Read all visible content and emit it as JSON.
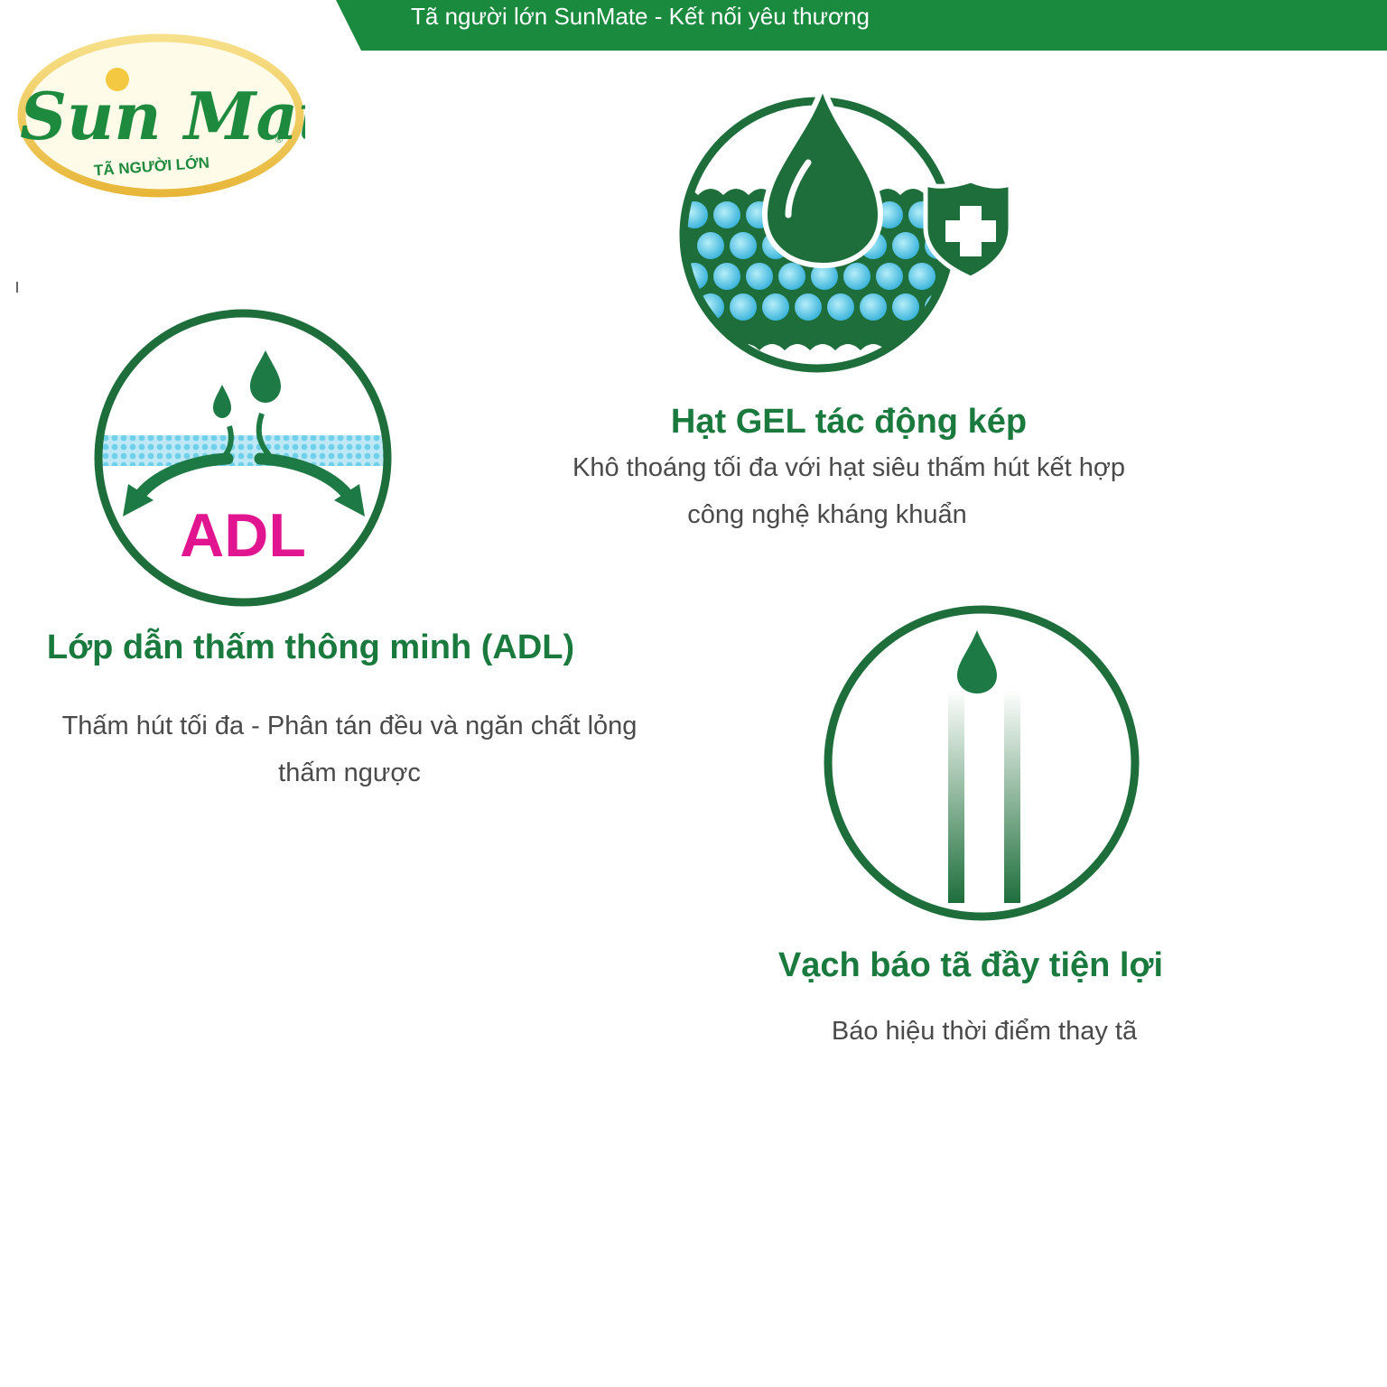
{
  "banner": {
    "text": "Tã người lớn SunMate - Kết nối yêu thương"
  },
  "logo": {
    "brand": "Sun Mate",
    "tagline": "TÃ NGƯỜI LỚN",
    "registered": "®"
  },
  "features": [
    {
      "icon": "gel-beads-droplet-shield-icon",
      "title": "Hạt GEL tác động kép",
      "lines": [
        "Khô thoáng tối đa với hạt siêu thấm hút kết hợp",
        "công nghệ kháng khuẩn"
      ]
    },
    {
      "icon": "adl-layer-icon",
      "icon_label": "ADL",
      "title": "Lớp dẫn thấm thông minh (ADL)",
      "lines": [
        "Thấm hút tối đa - Phân tán đều và ngăn chất lỏng",
        "thấm ngược"
      ]
    },
    {
      "icon": "wetness-indicator-icon",
      "title": "Vạch báo tã đầy tiện lợi",
      "lines": [
        "Báo hiệu thời điểm thay tã"
      ]
    }
  ],
  "colors": {
    "brand_green": "#1a7a3e",
    "icon_green": "#1e6e3c",
    "bead_blue": "#5fc9e6",
    "adl_pink": "#e0158f",
    "logo_gold": "#f2c94c"
  }
}
